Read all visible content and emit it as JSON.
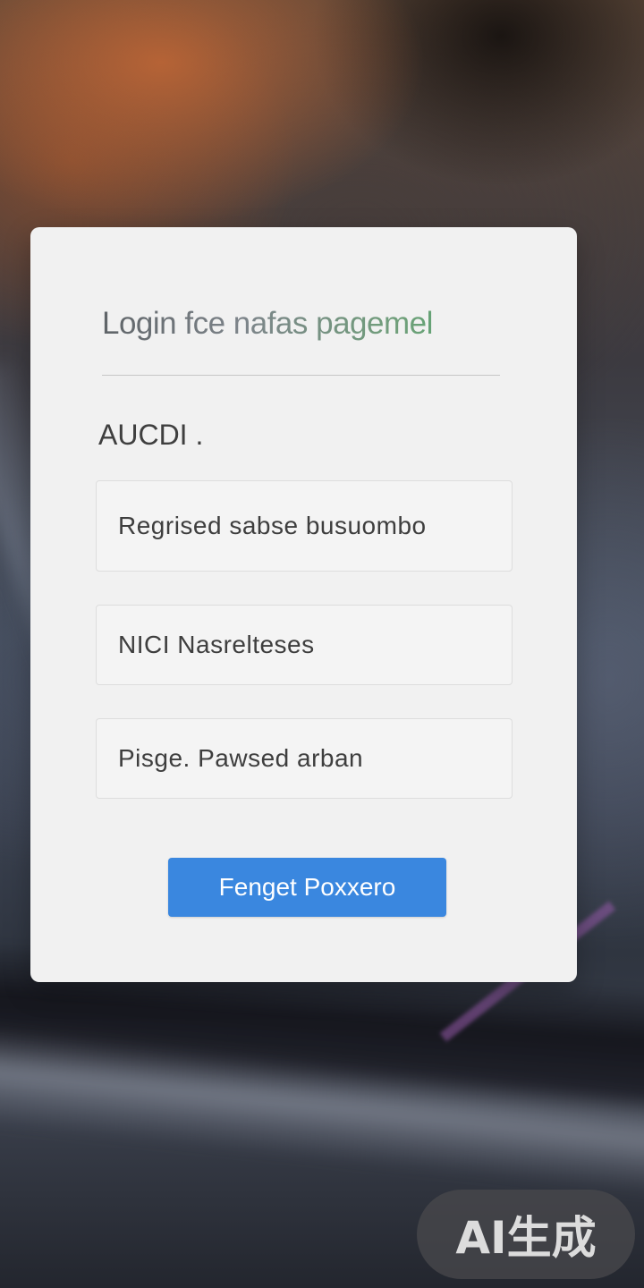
{
  "login_card": {
    "title": "Login fce nafas pagemel",
    "section_label": "AUCDI .",
    "fields": [
      {
        "value": "Regrised sabse busuombo"
      },
      {
        "value": "NICI Nasrelteses"
      },
      {
        "value": "Pisge. Pawsed arban"
      }
    ],
    "primary_button_label": "Fenget Poxxero"
  },
  "watermark": {
    "label": "AI生成"
  }
}
